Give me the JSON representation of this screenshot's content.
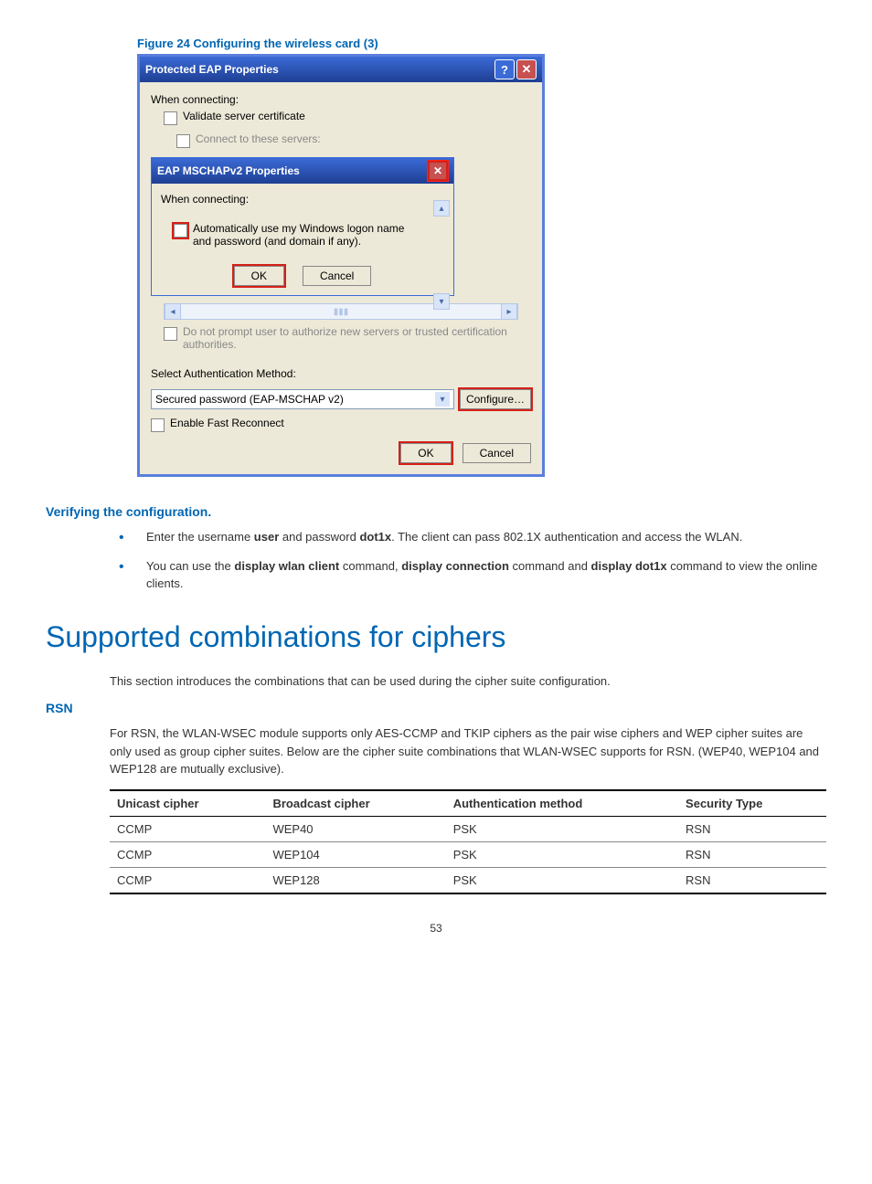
{
  "figure_caption": "Figure 24 Configuring the wireless card (3)",
  "outer_dialog": {
    "title": "Protected EAP Properties",
    "help_symbol": "?",
    "close_symbol": "✕",
    "when_connecting": "When connecting:",
    "validate_cert": "Validate server certificate",
    "connect_servers": "Connect to these servers:",
    "do_not_prompt": "Do not prompt user to authorize new servers or trusted certification authorities.",
    "select_auth_label": "Select Authentication Method:",
    "auth_method_value": "Secured password (EAP-MSCHAP v2)",
    "configure_button": "Configure…",
    "enable_fast_reconnect": "Enable Fast Reconnect",
    "ok": "OK",
    "cancel": "Cancel"
  },
  "inner_dialog": {
    "title": "EAP MSCHAPv2 Properties",
    "close_symbol": "✕",
    "when_connecting": "When connecting:",
    "auto_logon": "Automatically use my Windows logon name and password (and domain if any).",
    "ok": "OK",
    "cancel": "Cancel"
  },
  "verify_heading": "Verifying the configuration.",
  "bullets": [
    {
      "pre": "Enter the username ",
      "b1": "user",
      "mid1": " and password ",
      "b2": "dot1x",
      "post": ". The client can pass 802.1X authentication and access the WLAN."
    },
    {
      "pre": "You can use the ",
      "b1": "display wlan client",
      "mid1": " command, ",
      "b2": "display connection",
      "mid2": " command and ",
      "b3": "display dot1x",
      "post": " command to view the online clients."
    }
  ],
  "main_title": "Supported combinations for ciphers",
  "intro_para": "This section introduces the combinations that can be used during the cipher suite configuration.",
  "rsn_heading": "RSN",
  "rsn_para": "For RSN, the WLAN-WSEC module supports only AES-CCMP and TKIP ciphers as the pair wise ciphers and WEP cipher suites are only used as group cipher suites. Below are the cipher suite combinations that WLAN-WSEC supports for RSN. (WEP40, WEP104 and WEP128 are mutually exclusive).",
  "table": {
    "headers": [
      "Unicast cipher",
      "Broadcast cipher",
      "Authentication method",
      "Security Type"
    ],
    "rows": [
      [
        "CCMP",
        "WEP40",
        "PSK",
        "RSN"
      ],
      [
        "CCMP",
        "WEP104",
        "PSK",
        "RSN"
      ],
      [
        "CCMP",
        "WEP128",
        "PSK",
        "RSN"
      ]
    ]
  },
  "page_number": "53"
}
